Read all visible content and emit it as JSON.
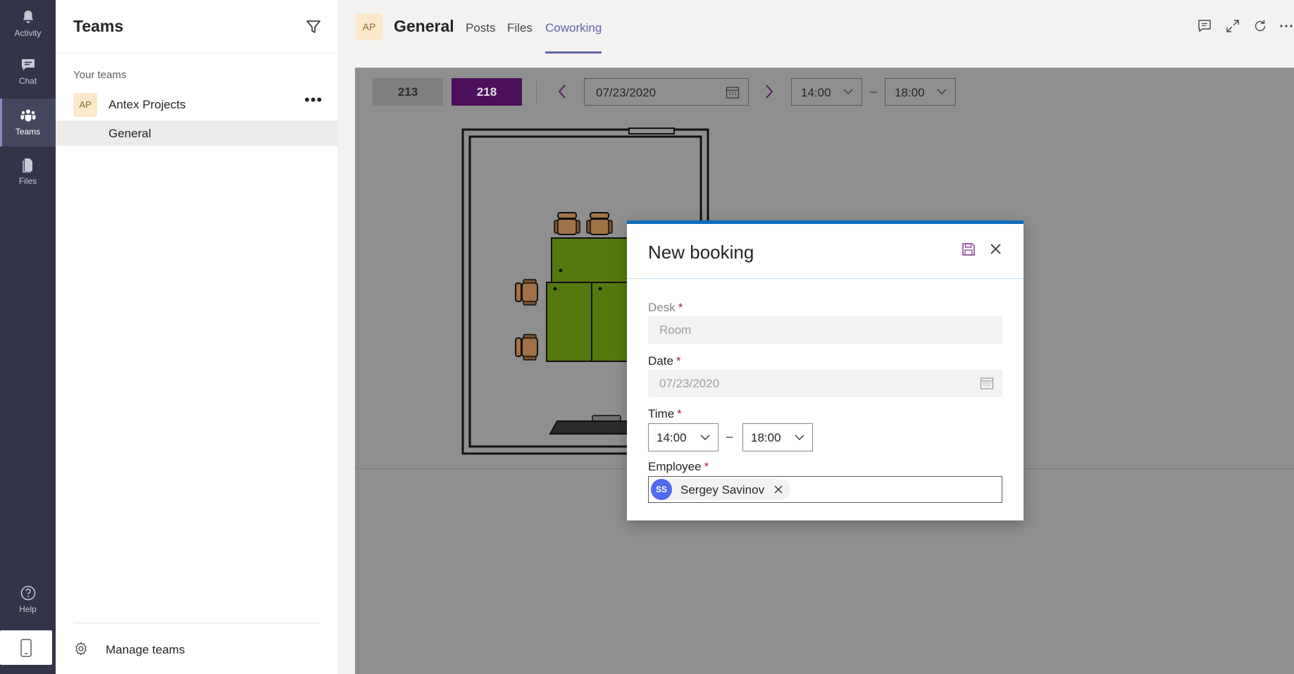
{
  "rail": {
    "items": [
      {
        "label": "Activity",
        "icon": "bell-icon"
      },
      {
        "label": "Chat",
        "icon": "chat-icon"
      },
      {
        "label": "Teams",
        "icon": "teams-icon",
        "active": true
      },
      {
        "label": "Files",
        "icon": "file-icon"
      }
    ],
    "help_label": "Help",
    "mobile_icon": "phone-icon"
  },
  "teams_panel": {
    "title": "Teams",
    "section_label": "Your teams",
    "team": {
      "initials": "AP",
      "name": "Antex Projects",
      "more": "•••"
    },
    "channel": {
      "name": "General"
    },
    "manage_label": "Manage teams"
  },
  "channel_header": {
    "initials": "AP",
    "title": "General",
    "tabs": [
      {
        "label": "Posts"
      },
      {
        "label": "Files"
      },
      {
        "label": "Coworking",
        "active": true
      }
    ],
    "right_icons": [
      "conversation-icon",
      "expand-icon",
      "reload-icon",
      "more-icon"
    ]
  },
  "toolbar": {
    "rooms": [
      {
        "label": "213",
        "selected": false
      },
      {
        "label": "218",
        "selected": true
      }
    ],
    "date": "07/23/2020",
    "time_from": "14:00",
    "time_separator": "–",
    "time_to": "18:00"
  },
  "dialog": {
    "title": "New booking",
    "desk_label": "Desk",
    "desk_value": "Room",
    "date_label": "Date",
    "date_value": "07/23/2020",
    "time_label": "Time",
    "time_from": "14:00",
    "time_separator": "–",
    "time_to": "18:00",
    "employee_label": "Employee",
    "employee": {
      "initials": "SS",
      "name": "Sergey Savinov"
    },
    "required_mark": "*"
  },
  "colors": {
    "rail_bg": "#33344a",
    "accent": "#6264a7",
    "room_selected": "#4c0f5a",
    "dialog_accent": "#0f6cbd",
    "table_green": "#547a0e",
    "chair_brown": "#a07245",
    "persona_blue": "#4f6bed"
  }
}
